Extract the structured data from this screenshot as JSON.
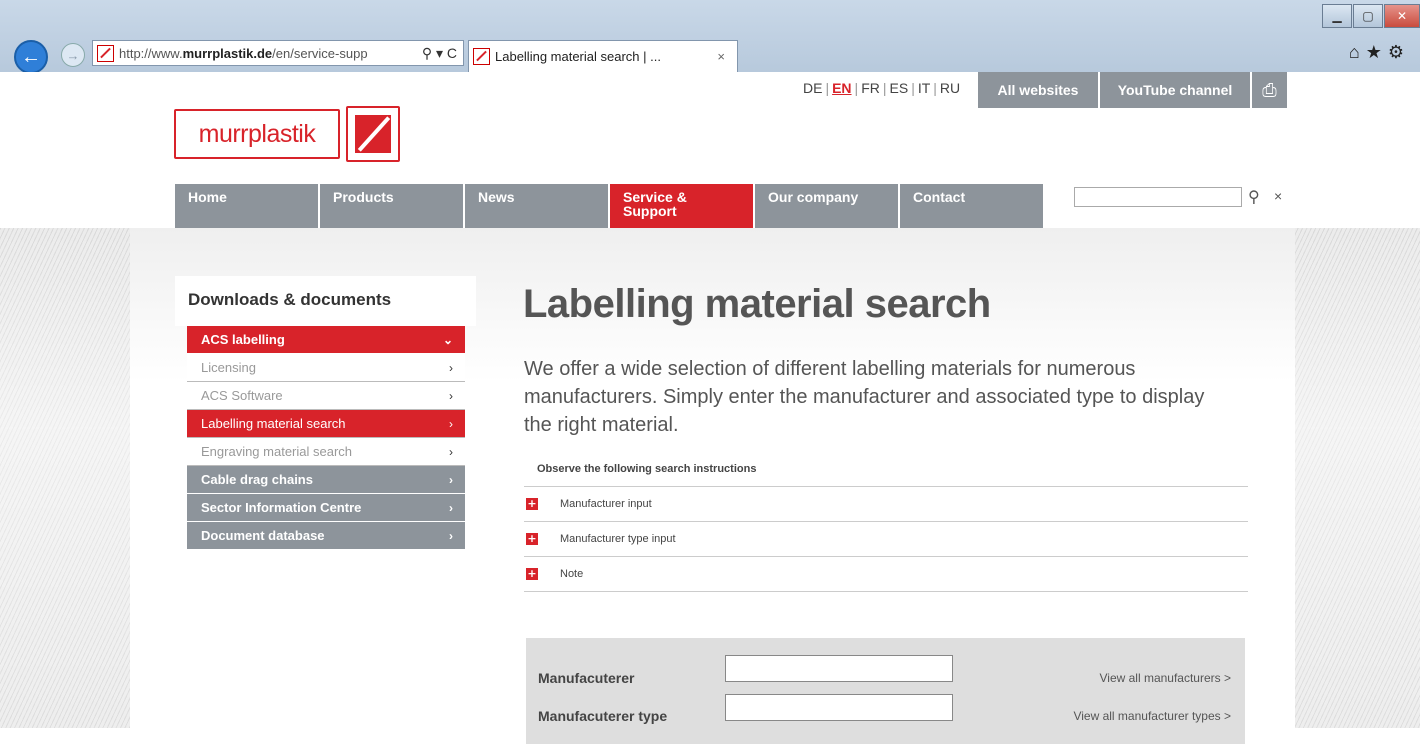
{
  "browser": {
    "address_prefix": "http://www.",
    "address_domain": "murrplastik.de",
    "address_suffix": "/en/service-supp",
    "address_icons": "⚲ ▾ C",
    "tab_title": "Labelling material search | ...",
    "tab_close": "×",
    "right_icons": "⌂★⚙"
  },
  "utility": {
    "languages": [
      "DE",
      "EN",
      "FR",
      "ES",
      "IT",
      "RU"
    ],
    "active_language": "EN",
    "all_websites": "All websites",
    "youtube": "YouTube channel",
    "print_icon": "⎙"
  },
  "logo": {
    "text": "murrplastik"
  },
  "nav": {
    "items": [
      "Home",
      "Products",
      "News",
      "Service & Support",
      "Our company",
      "Contact"
    ],
    "active": "Service & Support"
  },
  "search": {
    "icon": "⚲",
    "clear": "×"
  },
  "sidebar": {
    "title": "Downloads & documents",
    "items": [
      {
        "label": "ACS labelling",
        "chev": "⌄"
      },
      {
        "label": "Licensing",
        "chev": "›"
      },
      {
        "label": "ACS Software",
        "chev": "›"
      },
      {
        "label": "Labelling material search",
        "chev": "›"
      },
      {
        "label": "Engraving material search",
        "chev": "›"
      },
      {
        "label": "Cable drag chains",
        "chev": "›"
      },
      {
        "label": "Sector Information Centre",
        "chev": "›"
      },
      {
        "label": "Document database",
        "chev": "›"
      }
    ]
  },
  "main": {
    "title": "Labelling material search",
    "intro": "We offer a wide selection of different labelling materials for numerous manufacturers. Simply enter the manufacturer and associated type to display the right material.",
    "instructions_heading": "Observe the following search instructions",
    "accordion": [
      "Manufacturer input",
      "Manufacturer type input",
      "Note"
    ],
    "accordion_plus": "+"
  },
  "form": {
    "manufacturer_label": "Manufacuterer",
    "manufacturer_type_label": "Manufacuterer type",
    "view_manufacturers": "View all manufacturers  >",
    "view_types": "View all manufacturer types  >"
  },
  "colors": {
    "brand_red": "#d8232a",
    "nav_grey": "#8d949b"
  }
}
